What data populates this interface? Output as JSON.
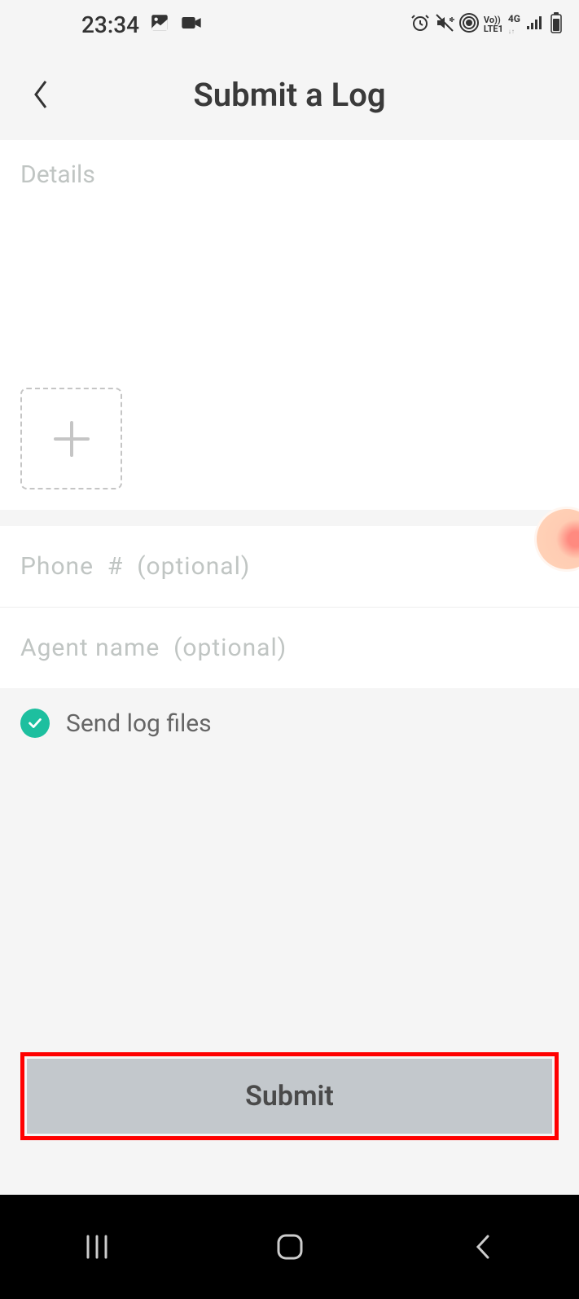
{
  "statusBar": {
    "time": "23:34"
  },
  "header": {
    "title": "Submit a Log"
  },
  "form": {
    "detailsPlaceholder": "Details",
    "phonePlaceholder": "Phone  #  (optional)",
    "agentPlaceholder": "Agent name  (optional)",
    "sendLogsLabel": "Send log files",
    "sendLogsChecked": true,
    "submitLabel": "Submit"
  }
}
